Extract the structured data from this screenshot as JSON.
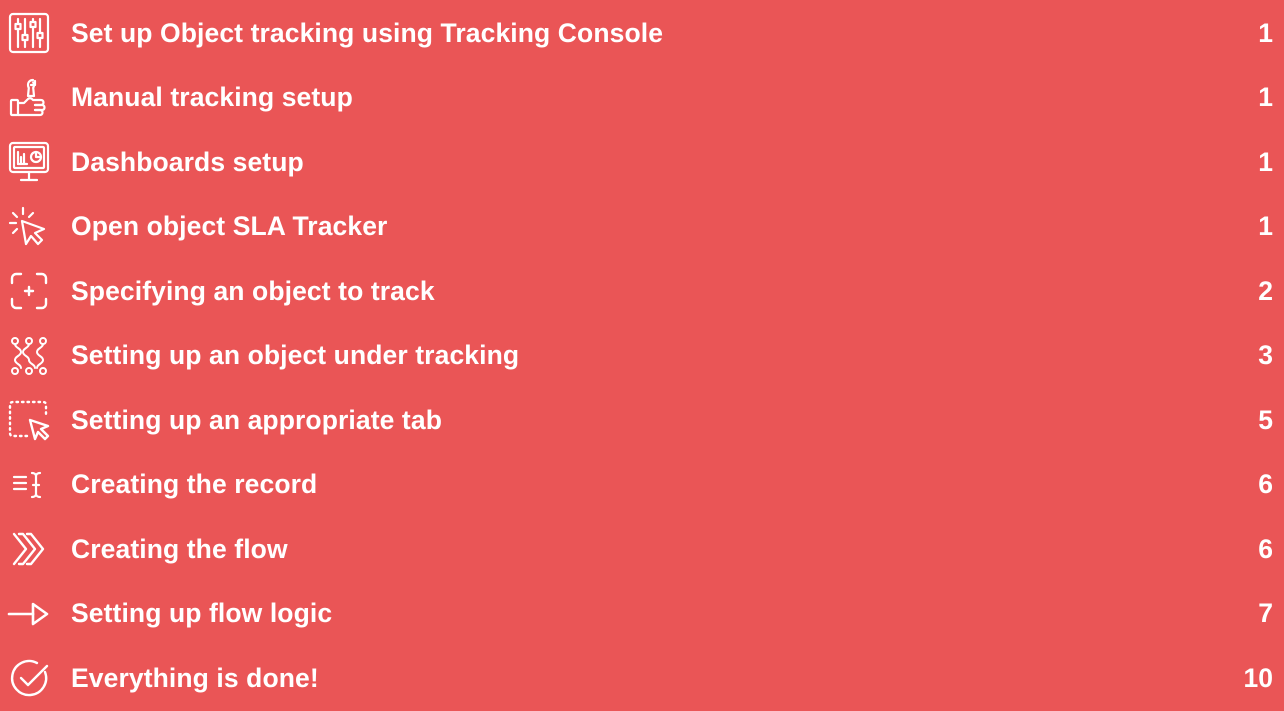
{
  "toc": {
    "items": [
      {
        "label": "Set up Object tracking using Tracking Console",
        "page": "1",
        "icon": "sliders-icon"
      },
      {
        "label": "Manual tracking setup",
        "page": "1",
        "icon": "hand-wrench-icon"
      },
      {
        "label": "Dashboards setup",
        "page": "1",
        "icon": "dashboard-monitor-icon"
      },
      {
        "label": "Open object SLA Tracker",
        "page": "1",
        "icon": "click-cursor-icon"
      },
      {
        "label": "Specifying an object to track",
        "page": "2",
        "icon": "target-frame-icon"
      },
      {
        "label": "Setting up an object under tracking",
        "page": "3",
        "icon": "network-nodes-icon"
      },
      {
        "label": "Setting up an appropriate tab",
        "page": "5",
        "icon": "selection-cursor-icon"
      },
      {
        "label": "Creating the record",
        "page": "6",
        "icon": "text-cursor-icon"
      },
      {
        "label": "Creating the flow",
        "page": "6",
        "icon": "double-chevron-icon"
      },
      {
        "label": "Setting up flow logic",
        "page": "7",
        "icon": "arrow-right-icon"
      },
      {
        "label": "Everything is done!",
        "page": "10",
        "icon": "check-circle-icon"
      }
    ]
  }
}
